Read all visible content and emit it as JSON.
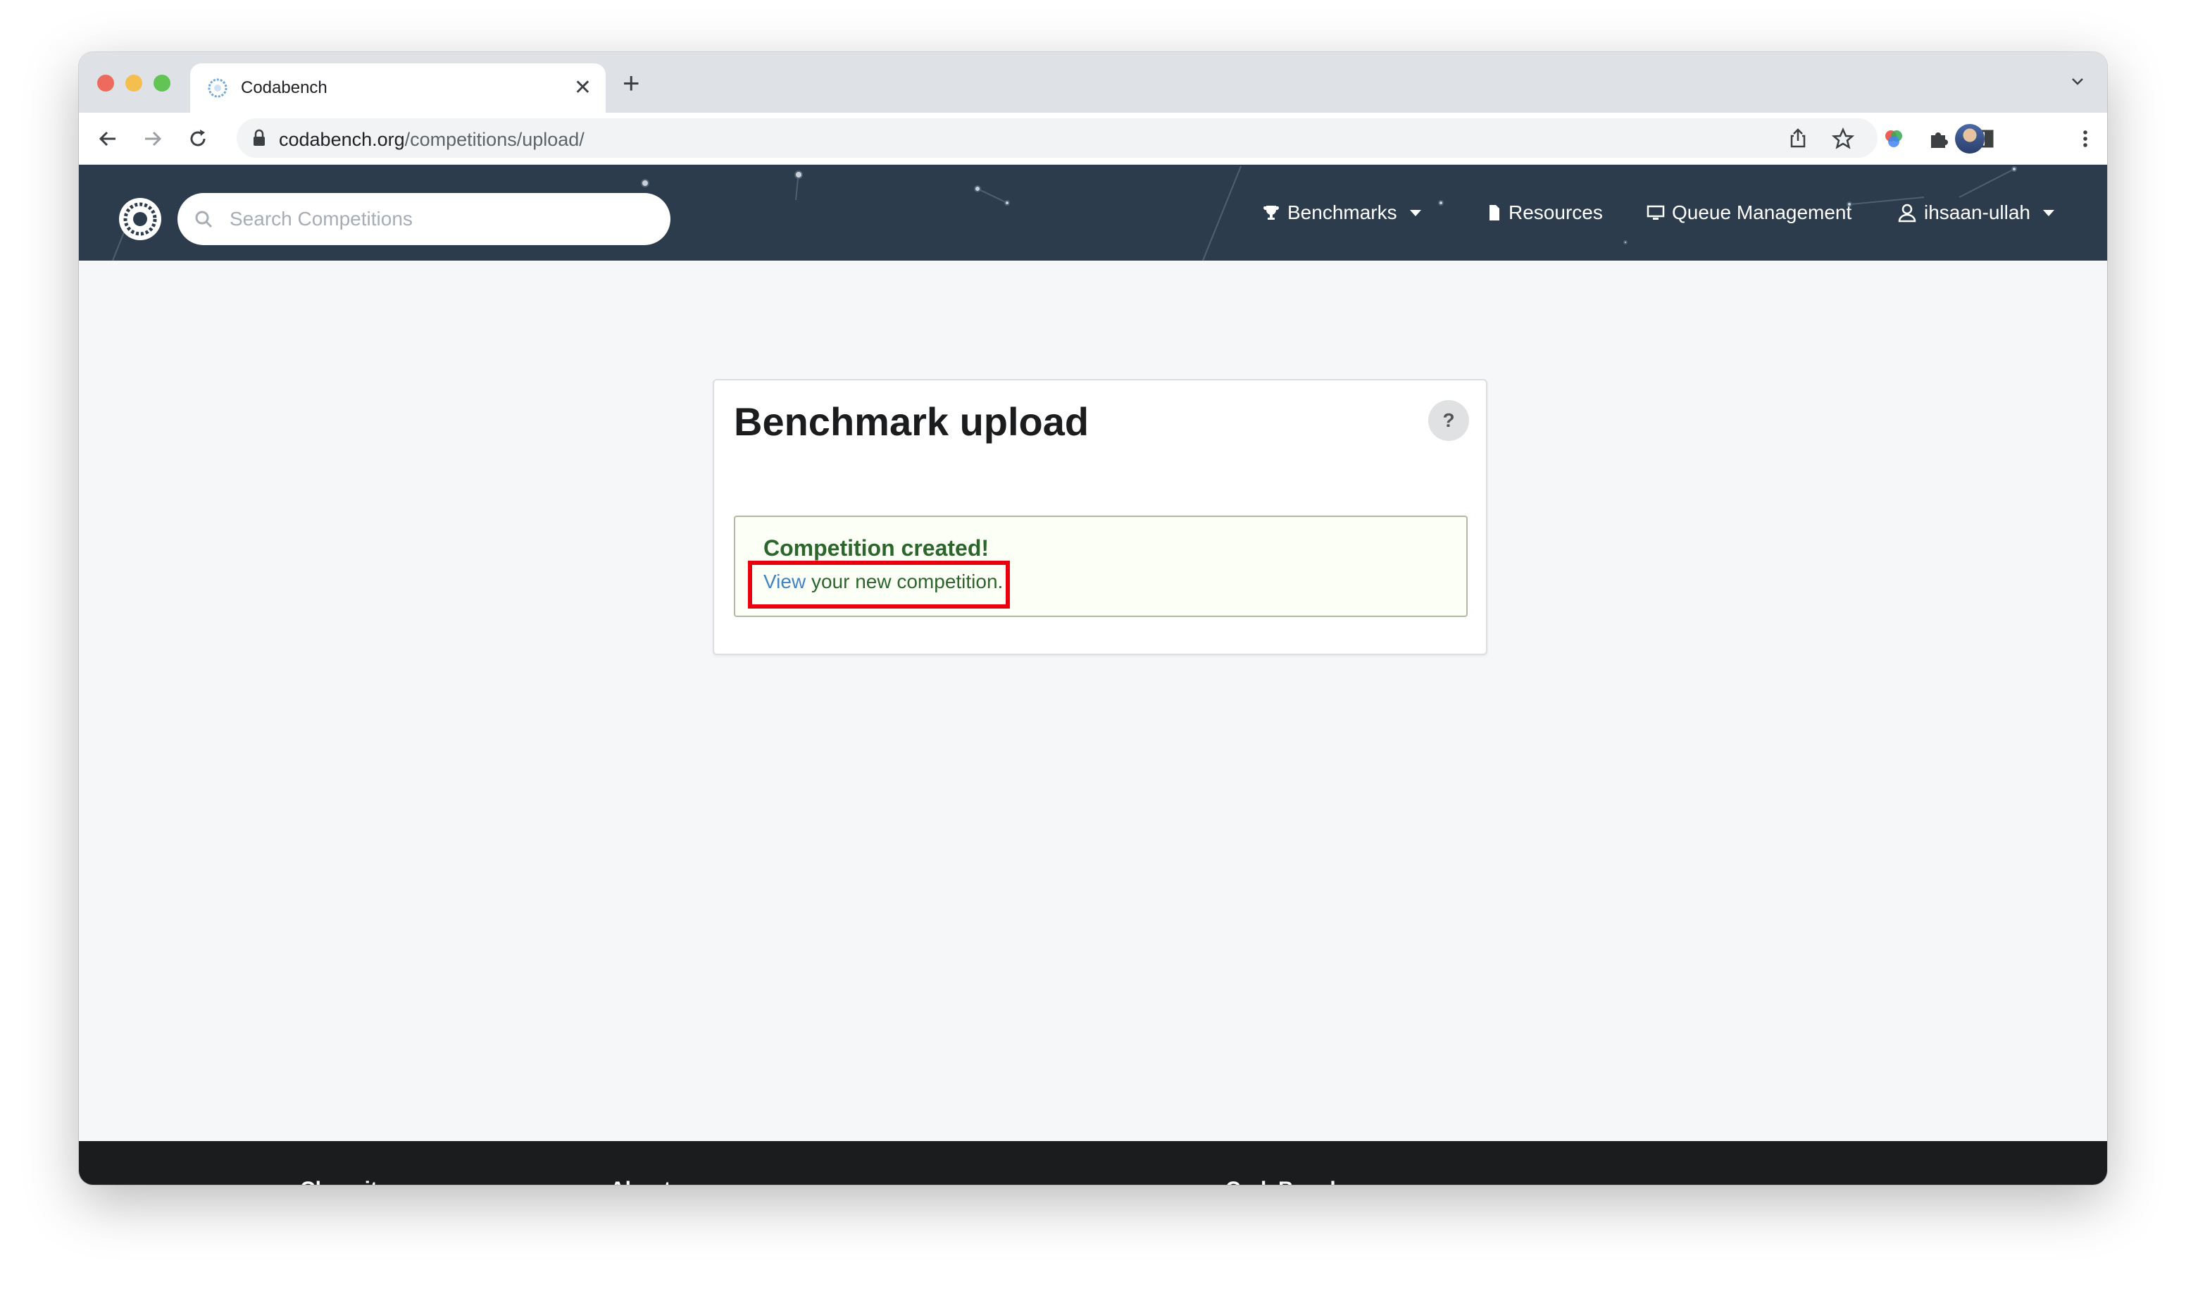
{
  "browser": {
    "tab_title": "Codabench",
    "url_domain": "codabench.org",
    "url_path": "/competitions/upload/"
  },
  "site": {
    "search_placeholder": "Search Competitions",
    "nav": {
      "benchmarks": "Benchmarks",
      "resources": "Resources",
      "queue_management": "Queue Management",
      "user": "ihsaan-ullah"
    }
  },
  "page": {
    "title": "Benchmark upload",
    "help_label": "?",
    "message": {
      "header": "Competition created!",
      "link_text": "View",
      "rest_text": " your new competition."
    }
  },
  "footer": {
    "col1": "Chasuite",
    "col2": "About",
    "col3": "CodaBench"
  },
  "colors": {
    "nav_bg": "#2d3c4d",
    "success_text": "#2c662d",
    "link": "#4183c4",
    "highlight": "#e8000f"
  }
}
